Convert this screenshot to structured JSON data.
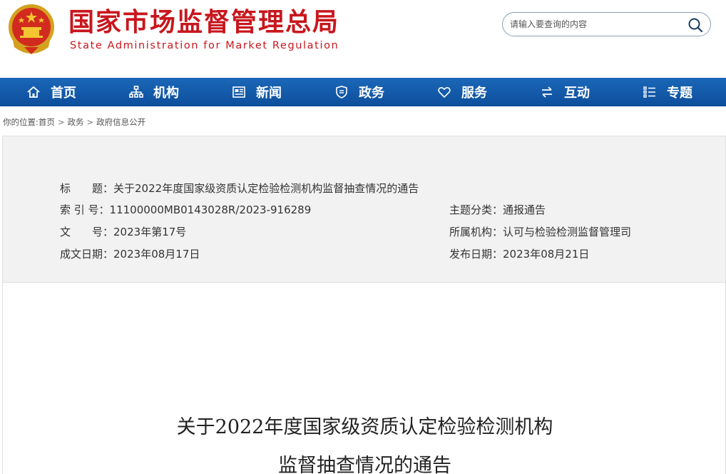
{
  "header": {
    "title": "国家市场监督管理总局",
    "subtitle": "State Administration for Market Regulation",
    "emblem_icon": "national-emblem-icon",
    "brand_color": "#c8161d"
  },
  "search": {
    "placeholder": "请输入要查询的内容",
    "icon": "search-icon"
  },
  "nav": {
    "background": "#1560b0",
    "items": [
      {
        "label": "首页",
        "icon": "home-icon"
      },
      {
        "label": "机构",
        "icon": "org-chart-icon"
      },
      {
        "label": "新闻",
        "icon": "newspaper-icon"
      },
      {
        "label": "政务",
        "icon": "shield-icon"
      },
      {
        "label": "服务",
        "icon": "heart-icon"
      },
      {
        "label": "互动",
        "icon": "swap-arrows-icon"
      },
      {
        "label": "专题",
        "icon": "list-icon"
      }
    ]
  },
  "breadcrumb": {
    "prefix": "你的位置:",
    "items": [
      "首页",
      "政务",
      "政府信息公开"
    ],
    "separator": ">"
  },
  "info": {
    "title_label": "标　　题：",
    "title_value": "关于2022年度国家级资质认定检验检测机构监督抽查情况的通告",
    "index_label": "索 引 号：",
    "index_value": "11100000MB0143028R/2023-916289",
    "category_label": "主题分类：",
    "category_value": "通报通告",
    "docno_label": "文　　号：",
    "docno_value": "2023年第17号",
    "org_label": "所属机构：",
    "org_value": "认可与检验检测监督管理司",
    "created_label": "成文日期：",
    "created_value": "2023年08月17日",
    "published_label": "发布日期：",
    "published_value": "2023年08月21日"
  },
  "document": {
    "title_line1": "关于2022年度国家级资质认定检验检测机构",
    "title_line2": "监督抽查情况的通告"
  }
}
